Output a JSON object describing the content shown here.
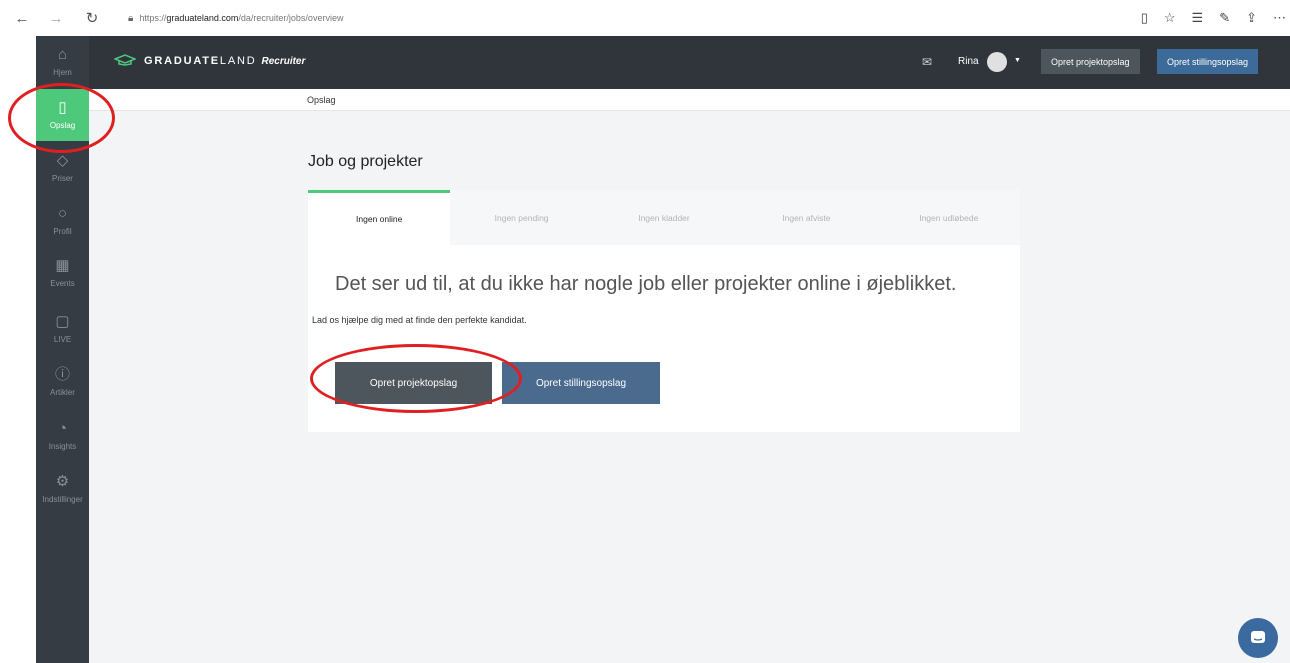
{
  "browser": {
    "back_icon": "←",
    "forward_icon": "→",
    "reload_icon": "↻",
    "url_prefix": "https://",
    "url_host": "graduateland.com",
    "url_path": "/da/recruiter/jobs/overview"
  },
  "sidebar": {
    "items": [
      {
        "label": "Hjem",
        "icon": "home-icon",
        "glyph": "⌂"
      },
      {
        "label": "Opslag",
        "icon": "document-icon",
        "glyph": "▯"
      },
      {
        "label": "Priser",
        "icon": "tag-icon",
        "glyph": "◇"
      },
      {
        "label": "Profil",
        "icon": "user-icon",
        "glyph": "○"
      },
      {
        "label": "Events",
        "icon": "calendar-icon",
        "glyph": "▦"
      },
      {
        "label": "LIVE",
        "icon": "chat-icon",
        "glyph": "▢"
      },
      {
        "label": "Artikler",
        "icon": "info-icon",
        "glyph": "ⓘ"
      },
      {
        "label": "Insights",
        "icon": "pie-chart-icon",
        "glyph": "◔"
      },
      {
        "label": "Indstillinger",
        "icon": "gear-icon",
        "glyph": "⚙"
      }
    ],
    "active_index": 1
  },
  "header": {
    "brand_bold": "GRADUATE",
    "brand_light": "LAND",
    "brand_suffix": "Recruiter",
    "user_name": "Rina",
    "btn_project": "Opret projektopslag",
    "btn_position": "Opret stillingsopslag"
  },
  "breadcrumb": "Opslag",
  "main": {
    "title": "Job og projekter",
    "tabs": [
      {
        "label": "Ingen online"
      },
      {
        "label": "Ingen pending"
      },
      {
        "label": "Ingen kladder"
      },
      {
        "label": "Ingen afviste"
      },
      {
        "label": "Ingen udløbede"
      }
    ],
    "active_tab": 0,
    "headline": "Det ser ud til, at du ikke har nogle job eller projekter online i øjeblikket.",
    "subline": "Lad os hjælpe dig med at finde den perfekte kandidat.",
    "btn_project": "Opret projektopslag",
    "btn_position": "Opret stillingsopslag"
  },
  "colors": {
    "accent_green": "#4ec87a",
    "sidebar_bg": "#353c43",
    "annotation_red": "#e02020"
  }
}
